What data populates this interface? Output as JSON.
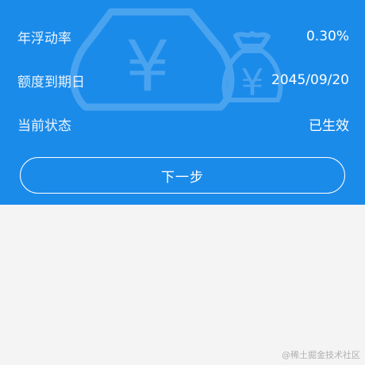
{
  "info": {
    "rows": [
      {
        "label": "年浮动率",
        "value": "0.30%"
      },
      {
        "label": "额度到期日",
        "value": "2045/09/20"
      },
      {
        "label": "当前状态",
        "value": "已生效"
      }
    ]
  },
  "actions": {
    "next_label": "下一步"
  },
  "background_art": {
    "currency_symbol": "¥",
    "icons": [
      "money-bag-icon",
      "small-money-bag-icon"
    ]
  },
  "watermark": "@稀土掘金技术社区",
  "colors": {
    "panel_blue": "#1b8bea",
    "page_background": "#f4f4f4",
    "text_white": "#ffffff"
  }
}
